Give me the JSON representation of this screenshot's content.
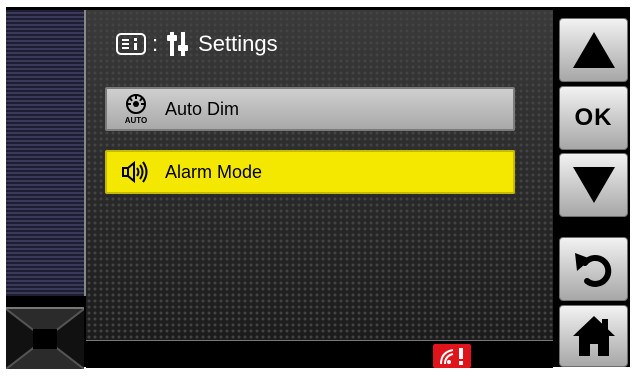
{
  "header": {
    "title": "Settings",
    "separator": ":"
  },
  "menu": {
    "items": [
      {
        "label": "Auto Dim",
        "icon": "auto-dim-icon",
        "icon_caption": "AUTO",
        "selected": false
      },
      {
        "label": "Alarm Mode",
        "icon": "speaker-icon",
        "selected": true
      }
    ]
  },
  "buttons": {
    "up": "up-arrow-icon",
    "ok_label": "OK",
    "down": "down-arrow-icon",
    "back": "back-icon",
    "home": "home-icon"
  },
  "status": {
    "alarm_icon": "alarm-alert-icon"
  },
  "colors": {
    "selected": "#f4e800",
    "unselected": "#b8b8b8",
    "alarm": "#e0151b"
  }
}
